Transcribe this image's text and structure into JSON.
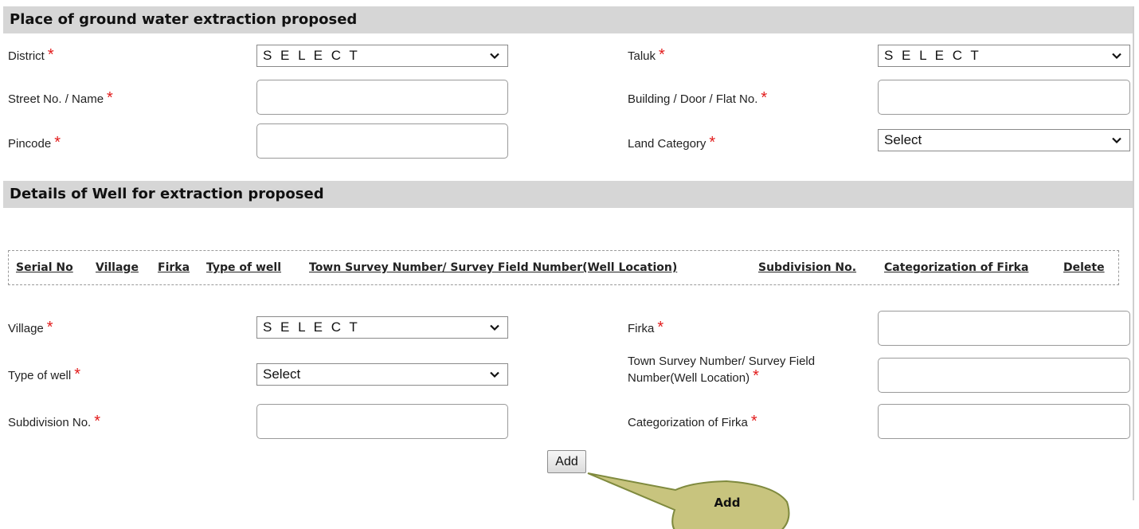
{
  "section1": {
    "title": "Place of ground water extraction proposed"
  },
  "fields1": {
    "district": {
      "label": "District",
      "value": "S E L E C T"
    },
    "taluk": {
      "label": "Taluk",
      "value": "S E L E C T"
    },
    "street": {
      "label": "Street No. / Name",
      "value": ""
    },
    "building": {
      "label": "Building / Door / Flat No.",
      "value": ""
    },
    "pincode": {
      "label": "Pincode",
      "value": ""
    },
    "land_category": {
      "label": "Land Category",
      "value": "Select"
    }
  },
  "section2": {
    "title": "Details of Well for extraction proposed"
  },
  "table": {
    "headers": [
      "Serial No",
      "Village",
      "Firka",
      "Type of well",
      "Town Survey Number/ Survey Field Number(Well Location)",
      "Subdivision No.",
      "Categorization of Firka",
      "Delete"
    ]
  },
  "fields2": {
    "village": {
      "label": "Village",
      "value": "S E L E C T"
    },
    "firka": {
      "label": "Firka",
      "value": ""
    },
    "type_of_well": {
      "label": "Type of well",
      "value": "Select"
    },
    "town_survey_line1": "Town Survey Number/ Survey Field",
    "town_survey_line2": "Number(Well Location)",
    "town_survey_value": "",
    "subdivision": {
      "label": "Subdivision No.",
      "value": ""
    },
    "categorization": {
      "label": "Categorization of Firka",
      "value": ""
    }
  },
  "required_mark": "*",
  "add_button": "Add",
  "callout": {
    "text": "Add"
  },
  "colors": {
    "required": "#e21b1b",
    "section_bg": "#d6d6d6",
    "callout_fill": "#c8c47e",
    "callout_stroke": "#7f8a3e"
  }
}
